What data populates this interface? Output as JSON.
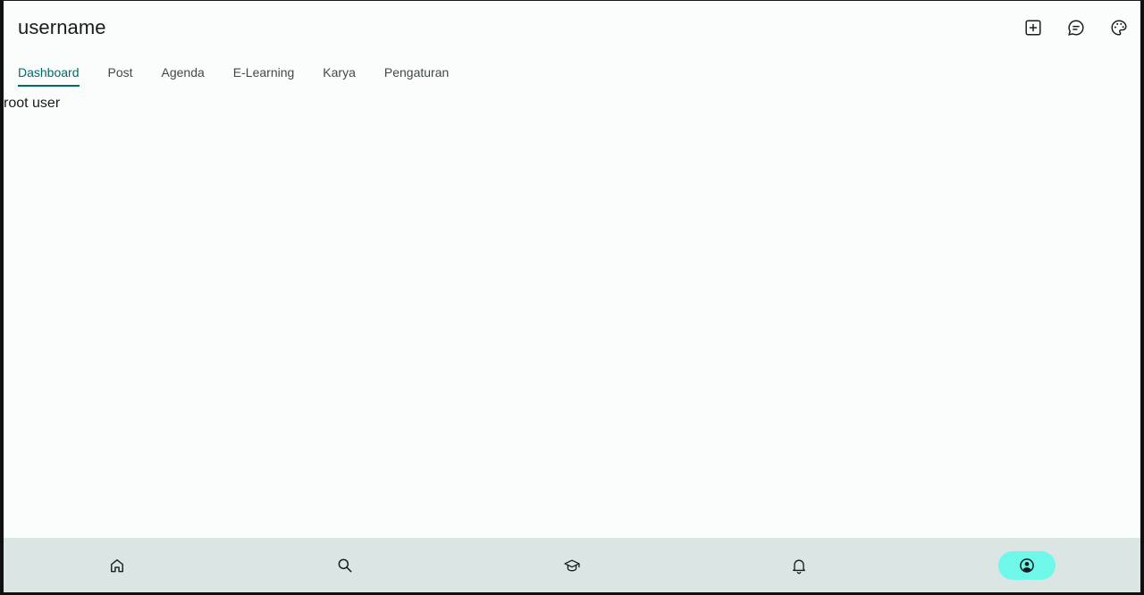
{
  "header": {
    "title": "username",
    "actions": [
      {
        "icon": "add-box-icon"
      },
      {
        "icon": "chat-icon"
      },
      {
        "icon": "palette-icon"
      }
    ]
  },
  "tabs": [
    {
      "label": "Dashboard",
      "active": true
    },
    {
      "label": "Post",
      "active": false
    },
    {
      "label": "Agenda",
      "active": false
    },
    {
      "label": "E-Learning",
      "active": false
    },
    {
      "label": "Karya",
      "active": false
    },
    {
      "label": "Pengaturan",
      "active": false
    }
  ],
  "content": {
    "text": "root user"
  },
  "bottom_nav": {
    "items": [
      {
        "icon": "home-icon",
        "active": false
      },
      {
        "icon": "search-icon",
        "active": false
      },
      {
        "icon": "school-icon",
        "active": false
      },
      {
        "icon": "bell-icon",
        "active": false
      },
      {
        "icon": "account-circle-icon",
        "active": true
      }
    ]
  },
  "colors": {
    "accent": "#006a66",
    "active_indicator": "#6ff7ea",
    "nav_background": "#dbe5e3",
    "surface": "#fafdfc"
  }
}
